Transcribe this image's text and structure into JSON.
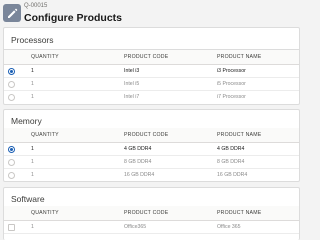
{
  "header": {
    "record_number": "Q-00015",
    "title": "Configure Products"
  },
  "sections": [
    {
      "title": "Processors",
      "selection": "radio",
      "columns": [
        "QUANTITY",
        "PRODUCT CODE",
        "PRODUCT NAME"
      ],
      "rows": [
        {
          "quantity": "1",
          "product_code": "Intel i3",
          "product_name": "i3 Processor",
          "selected": true
        },
        {
          "quantity": "1",
          "product_code": "Intel i5",
          "product_name": "i5 Processor",
          "selected": false
        },
        {
          "quantity": "1",
          "product_code": "Intel i7",
          "product_name": "i7 Processor",
          "selected": false
        }
      ]
    },
    {
      "title": "Memory",
      "selection": "radio",
      "columns": [
        "QUANTITY",
        "PRODUCT CODE",
        "PRODUCT NAME"
      ],
      "rows": [
        {
          "quantity": "1",
          "product_code": "4 GB DDR4",
          "product_name": "4 GB DDR4",
          "selected": true
        },
        {
          "quantity": "1",
          "product_code": "8 GB DDR4",
          "product_name": "8 GB DDR4",
          "selected": false
        },
        {
          "quantity": "1",
          "product_code": "16 GB DDR4",
          "product_name": "16 GB DDR4",
          "selected": false
        }
      ]
    },
    {
      "title": "Software",
      "selection": "checkbox",
      "columns": [
        "QUANTITY",
        "PRODUCT CODE",
        "PRODUCT NAME"
      ],
      "rows": [
        {
          "quantity": "1",
          "product_code": "Office365",
          "product_name": "Office 365",
          "selected": false
        }
      ]
    }
  ],
  "colors": {
    "accent": "#1b5fb4",
    "header_icon": "#7a869a"
  },
  "icons": {
    "header": "edit-pencil-icon"
  }
}
